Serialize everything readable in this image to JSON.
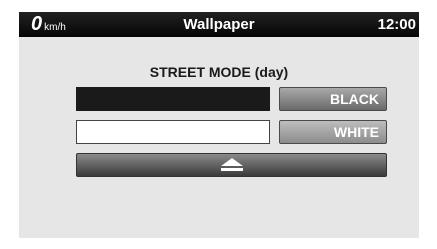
{
  "status_bar": {
    "speed_value": "0",
    "speed_unit": "km/h",
    "title": "Wallpaper",
    "clock": "12:00"
  },
  "mode_label": "STREET MODE (day)",
  "options": {
    "black_label": "BLACK",
    "white_label": "WHITE"
  },
  "colors": {
    "black_swatch": "#1a1a1a",
    "white_swatch": "#ffffff"
  },
  "icons": {
    "close_panel": "eject-icon"
  }
}
